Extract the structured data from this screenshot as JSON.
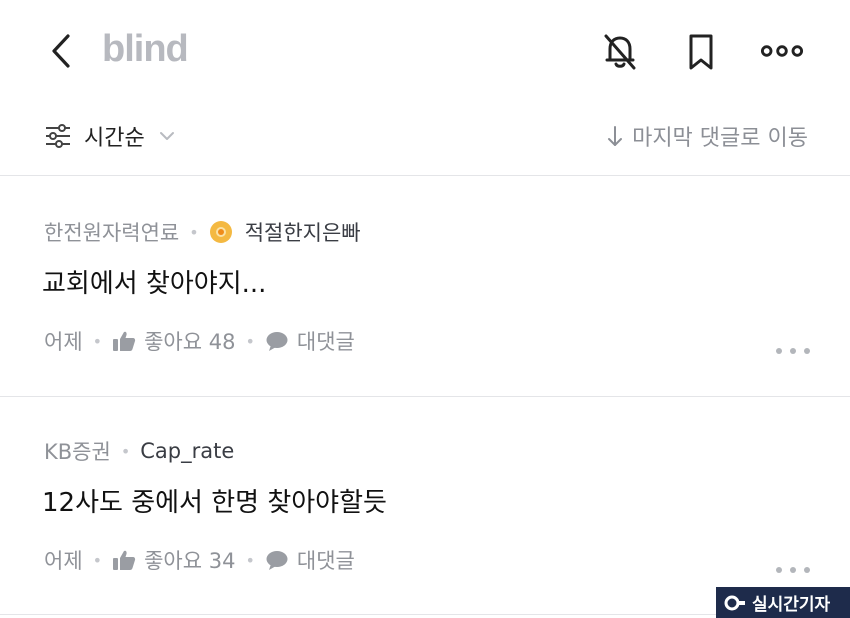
{
  "header": {
    "logo": "blind",
    "back_icon": "back-arrow-icon",
    "notification_icon": "bell-off-icon",
    "bookmark_icon": "bookmark-icon",
    "more_icon": "more-horizontal-icon"
  },
  "sort": {
    "label": "시간순",
    "icon": "sliders-icon",
    "jump_label": "마지막 댓글로 이동",
    "jump_icon": "arrow-down-icon"
  },
  "comments": [
    {
      "company": "한전원자력연료",
      "nickname": "적절한지은빠",
      "body": "교회에서 찾아야지...",
      "time": "어제",
      "like_label": "좋아요 48",
      "reply_label": "대댓글"
    },
    {
      "company": "KB증권",
      "nickname": "Cap_rate",
      "body": "12사도 중에서 한명 찾아야할듯",
      "time": "어제",
      "like_label": "좋아요 34",
      "reply_label": "대댓글"
    }
  ],
  "watermark": {
    "text": "실시간기자"
  },
  "colors": {
    "logo": "#b7b9bf",
    "muted_text": "#8f9298",
    "divider": "#e4e5e8",
    "badge": "#f4b942",
    "watermark_bg": "#1e2b4b"
  }
}
